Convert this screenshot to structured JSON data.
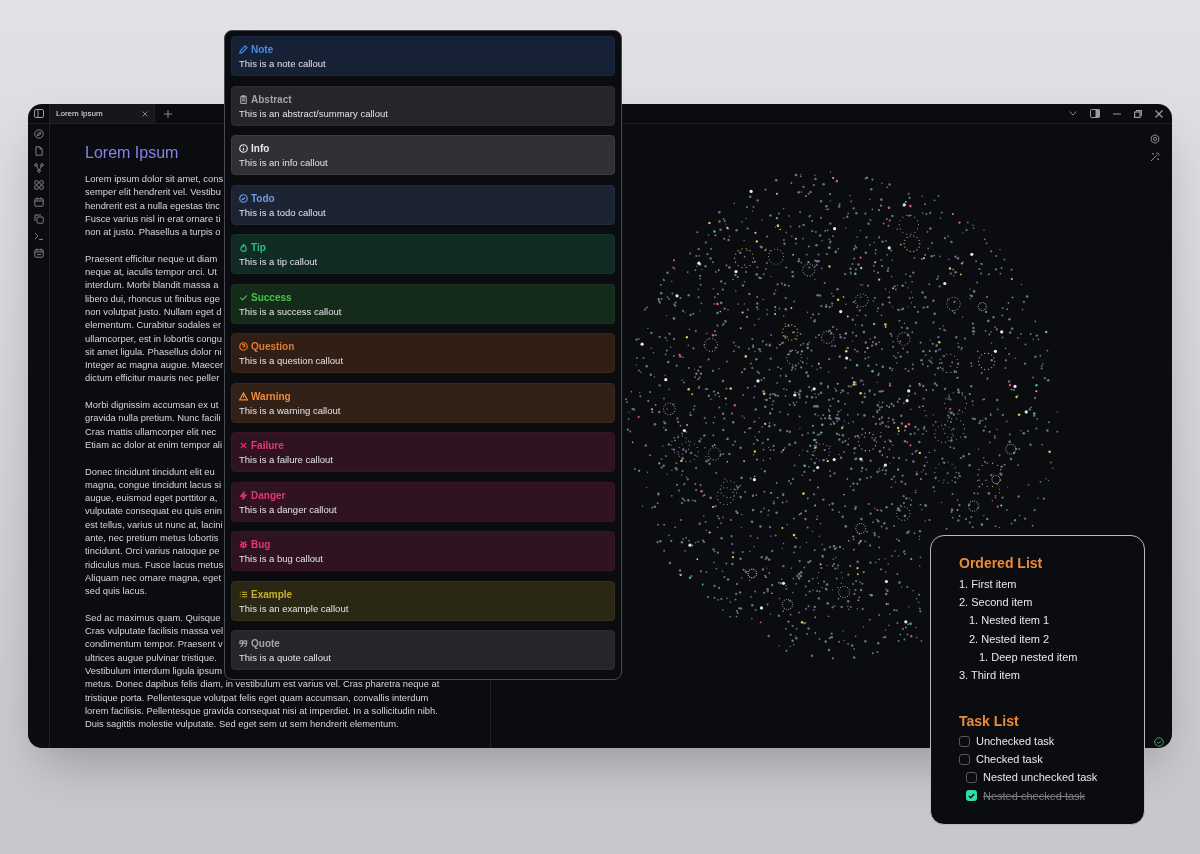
{
  "window": {
    "tabs": [
      {
        "label": "Lorem Ipsum",
        "selected": true
      }
    ]
  },
  "editor": {
    "title": "Lorem Ipsum",
    "paragraphs": [
      [
        "Lorem ipsum dolor sit amet, cons",
        "semper elit hendrerit vel. Vestibu",
        "hendrerit est a nulla egestas tinc",
        "Fusce varius nisl in erat ornare ti",
        "non at justo. Phasellus a turpis o"
      ],
      [
        "Praesent efficitur neque ut diam",
        "neque at, iaculis tempor orci. Ut",
        "interdum. Morbi blandit massa a",
        "libero dui, rhoncus ut finibus ege",
        "non volutpat justo. Nullam eget d",
        "elementum. Curabitur sodales er",
        "ullamcorper, est in lobortis congu",
        "sit amet ligula. Phasellus dolor ni",
        "Integer ac magna augue. Maecer",
        "dictum efficitur mauris nec peller"
      ],
      [
        "Morbi dignissim accumsan ex ut",
        "gravida nulla pretium. Nunc facili",
        "Cras mattis ullamcorper elit nec",
        "Etiam ac dolor at enim tempor ali"
      ],
      [
        "Donec tincidunt tincidunt elit eu",
        "magna, congue tincidunt lacus si",
        "augue, euismod eget porttitor a,",
        "vulputate consequat eu quis enin",
        "est tellus, varius ut nunc at, lacini",
        "ante, nec pretium metus lobortis",
        "tincidunt. Orci varius natoque pe",
        "ridiculus mus. Fusce lacus metus",
        "Aliquam nec ornare magna, eget",
        "sed quis lacus."
      ],
      [
        "Sed ac maximus quam. Quisque",
        "Cras vulputate facilisis massa vel",
        "condimentum tempor. Praesent v",
        "ultrices augue pulvinar tristique.",
        "Vestibulum interdum ligula ipsum",
        "metus. Donec dapibus felis diam, in vestibulum est varius vel. Cras pharetra neque at",
        "tristique porta. Pellentesque volutpat felis eget quam accumsan, convallis interdum",
        "lorem facilisis. Pellentesque gravida consequat nisi at imperdiet. In a sollicitudin nibh.",
        "Duis sagittis molestie vulputate. Sed eget sem ut sem hendrerit elementum."
      ]
    ]
  },
  "callouts": [
    {
      "kind": "note",
      "title": "Note",
      "text": "This is a note callout",
      "color": "#4a8ae8"
    },
    {
      "kind": "abstract",
      "title": "Abstract",
      "text": "This is an abstract/summary callout",
      "color": "#a3a3ab"
    },
    {
      "kind": "info",
      "title": "Info",
      "text": "This is an info callout",
      "color": "#e6e6ea"
    },
    {
      "kind": "todo",
      "title": "Todo",
      "text": "This is a todo callout",
      "color": "#6f9be6"
    },
    {
      "kind": "tip",
      "title": "Tip",
      "text": "This is a tip callout",
      "color": "#2bbf86"
    },
    {
      "kind": "success",
      "title": "Success",
      "text": "This is a success callout",
      "color": "#45c24b"
    },
    {
      "kind": "question",
      "title": "Question",
      "text": "This is a question callout",
      "color": "#e9792c"
    },
    {
      "kind": "warning",
      "title": "Warning",
      "text": "This is a warning callout",
      "color": "#ee8a3c"
    },
    {
      "kind": "failure",
      "title": "Failure",
      "text": "This is a failure callout",
      "color": "#e6366c"
    },
    {
      "kind": "danger",
      "title": "Danger",
      "text": "This is a danger callout",
      "color": "#e6366c"
    },
    {
      "kind": "bug",
      "title": "Bug",
      "text": "This is a bug callout",
      "color": "#e6366c"
    },
    {
      "kind": "example",
      "title": "Example",
      "text": "This is an example callout",
      "color": "#c4b22e"
    },
    {
      "kind": "quote",
      "title": "Quote",
      "text": "This is a quote callout",
      "color": "#a3a3ab"
    }
  ],
  "ordered_list": {
    "title": "Ordered List",
    "items": [
      {
        "marker": "1.",
        "text": "First item"
      },
      {
        "marker": "2.",
        "text": "Second item",
        "children": [
          {
            "marker": "1.",
            "text": "Nested item 1"
          },
          {
            "marker": "2.",
            "text": "Nested item 2",
            "children": [
              {
                "marker": "1.",
                "text": "Deep nested item"
              }
            ]
          }
        ]
      },
      {
        "marker": "3.",
        "text": "Third item"
      }
    ]
  },
  "task_list": {
    "title": "Task List",
    "items": [
      {
        "text": "Unchecked task",
        "checked": false
      },
      {
        "text": "Checked task",
        "checked": false,
        "children": [
          {
            "text": "Nested unchecked task",
            "checked": false
          },
          {
            "text": "Nested checked task",
            "checked": true
          }
        ]
      }
    ]
  }
}
